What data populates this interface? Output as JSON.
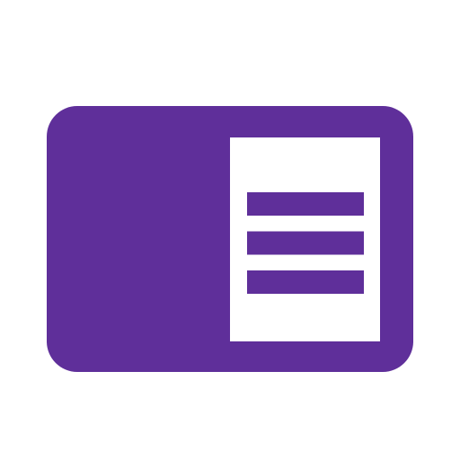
{
  "icon": {
    "name": "document-card-icon",
    "background_color": "#ffffff",
    "card_color": "#5f2f9a",
    "page_color": "#ffffff",
    "line_color": "#5f2f9a",
    "line_count": 3
  }
}
